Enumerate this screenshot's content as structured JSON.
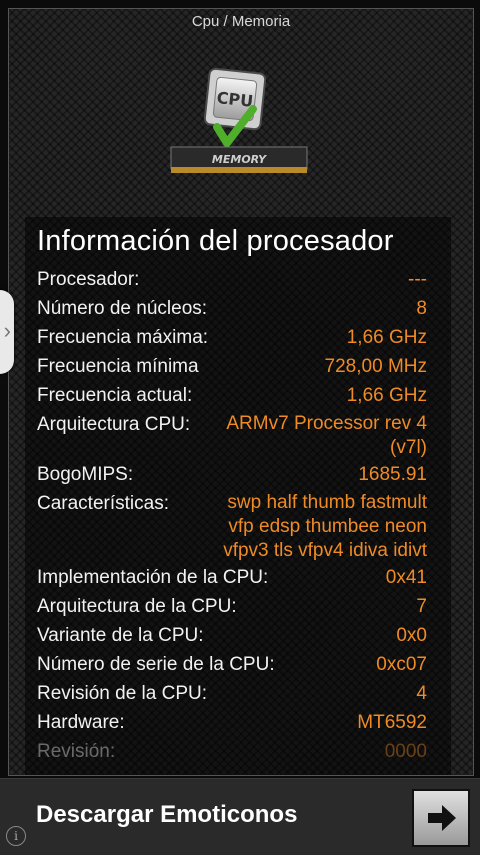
{
  "window": {
    "title": "Cpu / Memoria"
  },
  "logo": {
    "icon": "cpu-memory-icon",
    "cpu_text": "CPU",
    "memory_text": "MEMORY"
  },
  "panel": {
    "heading": "Información del procesador",
    "rows": [
      {
        "label": "Procesador:",
        "value": "---"
      },
      {
        "label": "Número de núcleos:",
        "value": "8"
      },
      {
        "label": "Frecuencia máxima:",
        "value": "1,66 GHz"
      },
      {
        "label": "Frecuencia mínima",
        "value": "728,00 MHz"
      },
      {
        "label": "Frecuencia actual:",
        "value": "1,66 GHz"
      },
      {
        "label": "Arquitectura CPU:",
        "value_lines": [
          "ARMv7 Processor rev 4",
          "(v7l)"
        ]
      },
      {
        "label": "BogoMIPS:",
        "value": "1685.91"
      },
      {
        "label": "Características:",
        "value_lines": [
          "swp half thumb fastmult",
          "vfp edsp thumbee neon",
          "vfpv3 tls vfpv4 idiva idivt"
        ]
      },
      {
        "label": "Implementación de la CPU:",
        "value": "0x41"
      },
      {
        "label": "Arquitectura de la CPU:",
        "value": "7"
      },
      {
        "label": "Variante de la CPU:",
        "value": "0x0"
      },
      {
        "label": "Número de serie de la CPU:",
        "value": "0xc07"
      },
      {
        "label": "Revisión de la CPU:",
        "value": "4"
      },
      {
        "label": "Hardware:",
        "value": "MT6592"
      },
      {
        "label": "Revisión:",
        "value": "0000"
      }
    ]
  },
  "side_tab": {
    "icon": "chevron-right-icon",
    "glyph": "›"
  },
  "ad": {
    "text": "Descargar Emoticonos",
    "button_icon": "arrow-right-icon",
    "info_icon": "info-icon",
    "info_glyph": "i"
  },
  "colors": {
    "value": "#ef8b27",
    "label": "#f2f2f2",
    "background": "#262626"
  }
}
